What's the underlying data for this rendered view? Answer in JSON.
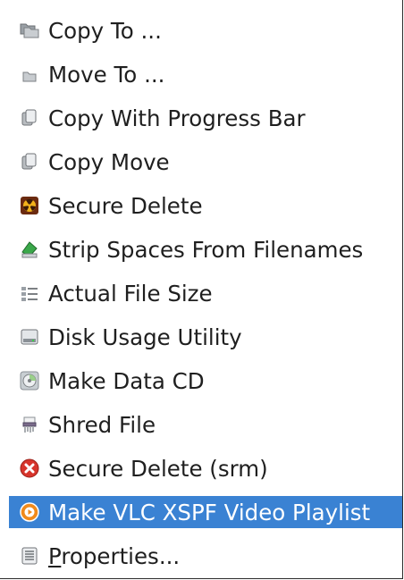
{
  "menu": {
    "items": [
      {
        "label": "Copy To ...",
        "icon": "folders-icon"
      },
      {
        "label": "Move To ...",
        "icon": "folder-icon"
      },
      {
        "label": "Copy With Progress Bar",
        "icon": "copy-icon"
      },
      {
        "label": "Copy Move",
        "icon": "copy-icon"
      },
      {
        "label": "Secure Delete",
        "icon": "radiation-icon"
      },
      {
        "label": "Strip Spaces From Filenames",
        "icon": "rename-icon"
      },
      {
        "label": "Actual File Size",
        "icon": "details-list-icon"
      },
      {
        "label": "Disk Usage Utility",
        "icon": "disk-icon"
      },
      {
        "label": "Make Data CD",
        "icon": "cd-icon"
      },
      {
        "label": "Shred File",
        "icon": "shredder-icon"
      },
      {
        "label": "Secure Delete (srm)",
        "icon": "red-x-icon"
      },
      {
        "label": "Make VLC XSPF Video Playlist",
        "icon": "vlc-icon",
        "highlighted": true
      },
      {
        "label_mnemonic": "P",
        "label_rest": "roperties...",
        "icon": "properties-icon"
      }
    ]
  },
  "colors": {
    "highlight": "#3a82d3",
    "text": "#1f1f1f",
    "highlight_text": "#ffffff"
  }
}
